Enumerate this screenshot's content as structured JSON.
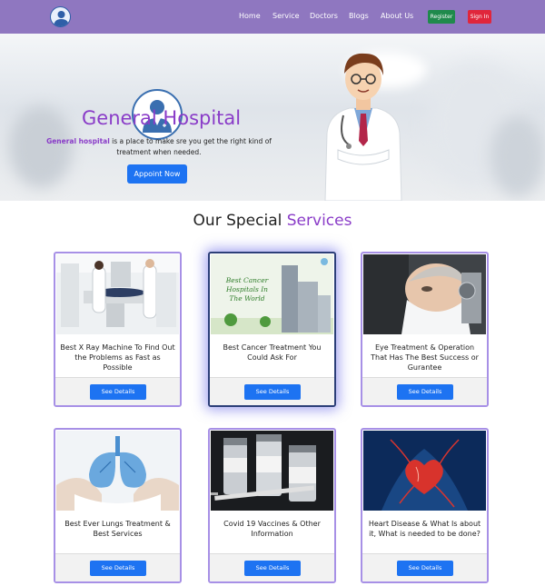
{
  "nav": {
    "links": [
      "Home",
      "Service",
      "Doctors",
      "Blogs",
      "About Us"
    ],
    "register": "Register",
    "signin": "Sign In"
  },
  "hero": {
    "title": "General Hospital",
    "desc_strong": "General hospital",
    "desc_rest": " is a place to make sre you get the right kind of treatment when needed.",
    "button": "Appoint Now"
  },
  "section": {
    "title_main": "Our Special ",
    "title_accent": "Services"
  },
  "cards": [
    {
      "text": "Best X Ray Machine To Find Out the Problems as Fast as Possible",
      "button": "See Details"
    },
    {
      "text": "Best Cancer Treatment You Could Ask For",
      "button": "See Details",
      "img_text": "Best Cancer Hospitals In The World"
    },
    {
      "text": "Eye Treatment & Operation That Has The Best Success or Gurantee",
      "button": "See Details"
    },
    {
      "text": "Best Ever Lungs Treatment & Best Services",
      "button": "See Details"
    },
    {
      "text": "Covid 19 Vaccines & Other Information",
      "button": "See Details"
    },
    {
      "text": "Heart Disease & What Is about it, What is needed to be done?",
      "button": "See Details"
    }
  ],
  "colors": {
    "navbar": "#8f77c0",
    "accent": "#8a3cc8",
    "primary_button": "#1d73f2",
    "register": "#1f8a4c",
    "signin": "#e0263b"
  }
}
